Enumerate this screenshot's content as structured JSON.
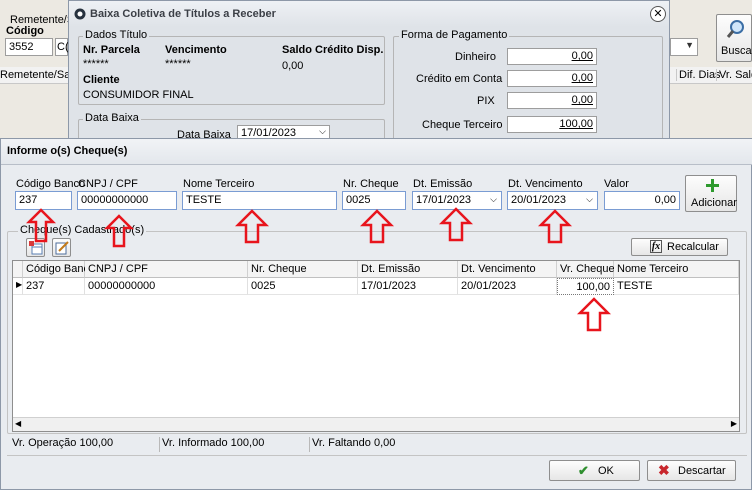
{
  "bg": {
    "remetente_label": "Remetente/S",
    "codigo_label": "Código",
    "codigo_value": "3552",
    "codigo_value2": "C(",
    "buscar_label": "Buscar",
    "col_remetente": "Remetente/Saca",
    "col_dif_dias": "Dif. Dias",
    "col_vr_saldo": "Vr. Sald"
  },
  "dialog1": {
    "title": "Baixa Coletiva de Títulos a Receber",
    "dados_titulo": "Dados Título",
    "nr_parcela_label": "Nr. Parcela",
    "nr_parcela_value": "******",
    "vencimento_label": "Vencimento",
    "vencimento_value": "******",
    "saldo_label": "Saldo Crédito Disp.",
    "saldo_value": "0,00",
    "cliente_label": "Cliente",
    "cliente_value": "CONSUMIDOR FINAL",
    "data_baixa_group": "Data Baixa",
    "data_baixa_label": "Data Baixa",
    "data_baixa_value": "17/01/2023",
    "forma_pagamento": "Forma de Pagamento",
    "payments": [
      {
        "label": "Dinheiro",
        "value": "0,00"
      },
      {
        "label": "Crédito em Conta",
        "value": "0,00"
      },
      {
        "label": "PIX",
        "value": "0,00"
      },
      {
        "label": "Cheque Terceiro",
        "value": "100,00"
      }
    ]
  },
  "dialog2": {
    "title": "Informe o(s) Cheque(s)",
    "form": {
      "codigo_banco_label": "Código Banco",
      "codigo_banco_value": "237",
      "cnpj_label": "CNPJ / CPF",
      "cnpj_value": "00000000000",
      "nome_label": "Nome Terceiro",
      "nome_value": "TESTE",
      "nr_cheque_label": "Nr. Cheque",
      "nr_cheque_value": "0025",
      "dt_emissao_label": "Dt. Emissão",
      "dt_emissao_value": "17/01/2023",
      "dt_venc_label": "Dt. Vencimento",
      "dt_venc_value": "20/01/2023",
      "valor_label": "Valor",
      "valor_value": "0,00",
      "adicionar_label": "Adicionar"
    },
    "cadastrados_label": "Cheque(s) Cadastrado(s)",
    "recalcular_label": "Recalcular",
    "grid": {
      "columns": [
        "Código Banco",
        "CNPJ / CPF",
        "Nr. Cheque",
        "Dt. Emissão",
        "Dt. Vencimento",
        "Vr. Cheque",
        "Nome Terceiro"
      ],
      "rows": [
        [
          "237",
          "00000000000",
          "0025",
          "17/01/2023",
          "20/01/2023",
          "100,00",
          "TESTE"
        ]
      ]
    },
    "status": {
      "operacao": "Vr. Operação 100,00",
      "informado": "Vr. Informado 100,00",
      "faltando": "Vr. Faltando 0,00"
    },
    "ok_label": "OK",
    "descartar_label": "Descartar"
  },
  "colors": {
    "annotation_arrow": "#e8141c",
    "add_green": "#2e9a2e",
    "ok_green": "#2f8f2f",
    "cancel_red": "#c8262c"
  }
}
